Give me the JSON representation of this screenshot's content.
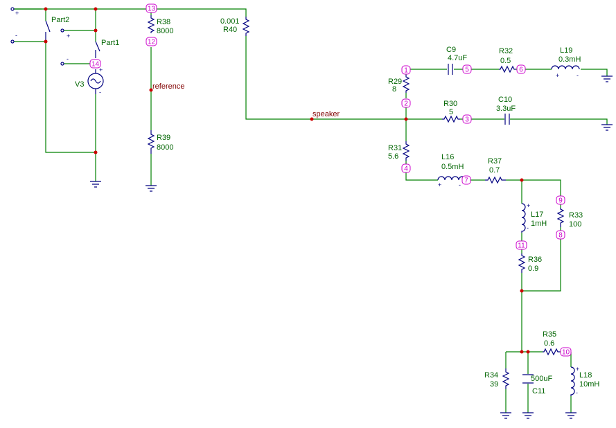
{
  "components": {
    "R38": {
      "name": "R38",
      "value": "8000"
    },
    "R39": {
      "name": "R39",
      "value": "8000"
    },
    "R40": {
      "name": "R40",
      "value": "0.001"
    },
    "R29": {
      "name": "R29",
      "value": "8"
    },
    "R30": {
      "name": "R30",
      "value": "5"
    },
    "R31": {
      "name": "R31",
      "value": "5.6"
    },
    "R32": {
      "name": "R32",
      "value": "0.5"
    },
    "R33": {
      "name": "R33",
      "value": "100"
    },
    "R34": {
      "name": "R34",
      "value": "39"
    },
    "R35": {
      "name": "R35",
      "value": "0.6"
    },
    "R36": {
      "name": "R36",
      "value": "0.9"
    },
    "R37": {
      "name": "R37",
      "value": "0.7"
    },
    "C9": {
      "name": "C9",
      "value": "4.7uF"
    },
    "C10": {
      "name": "C10",
      "value": "3.3uF"
    },
    "C11": {
      "name": "C11",
      "value": "500uF"
    },
    "L16": {
      "name": "L16",
      "value": "0.5mH"
    },
    "L17": {
      "name": "L17",
      "value": "1mH"
    },
    "L18": {
      "name": "L18",
      "value": "10mH"
    },
    "L19": {
      "name": "L19",
      "value": "0.3mH"
    },
    "V3": {
      "name": "V3"
    },
    "Part1": {
      "name": "Part1"
    },
    "Part2": {
      "name": "Part2"
    }
  },
  "nets": {
    "reference": "reference",
    "speaker": "speaker"
  },
  "nodes": [
    "1",
    "2",
    "3",
    "4",
    "5",
    "6",
    "7",
    "8",
    "9",
    "10",
    "11",
    "12",
    "13",
    "14"
  ],
  "polarity": {
    "plus": "+",
    "minus": "-"
  }
}
